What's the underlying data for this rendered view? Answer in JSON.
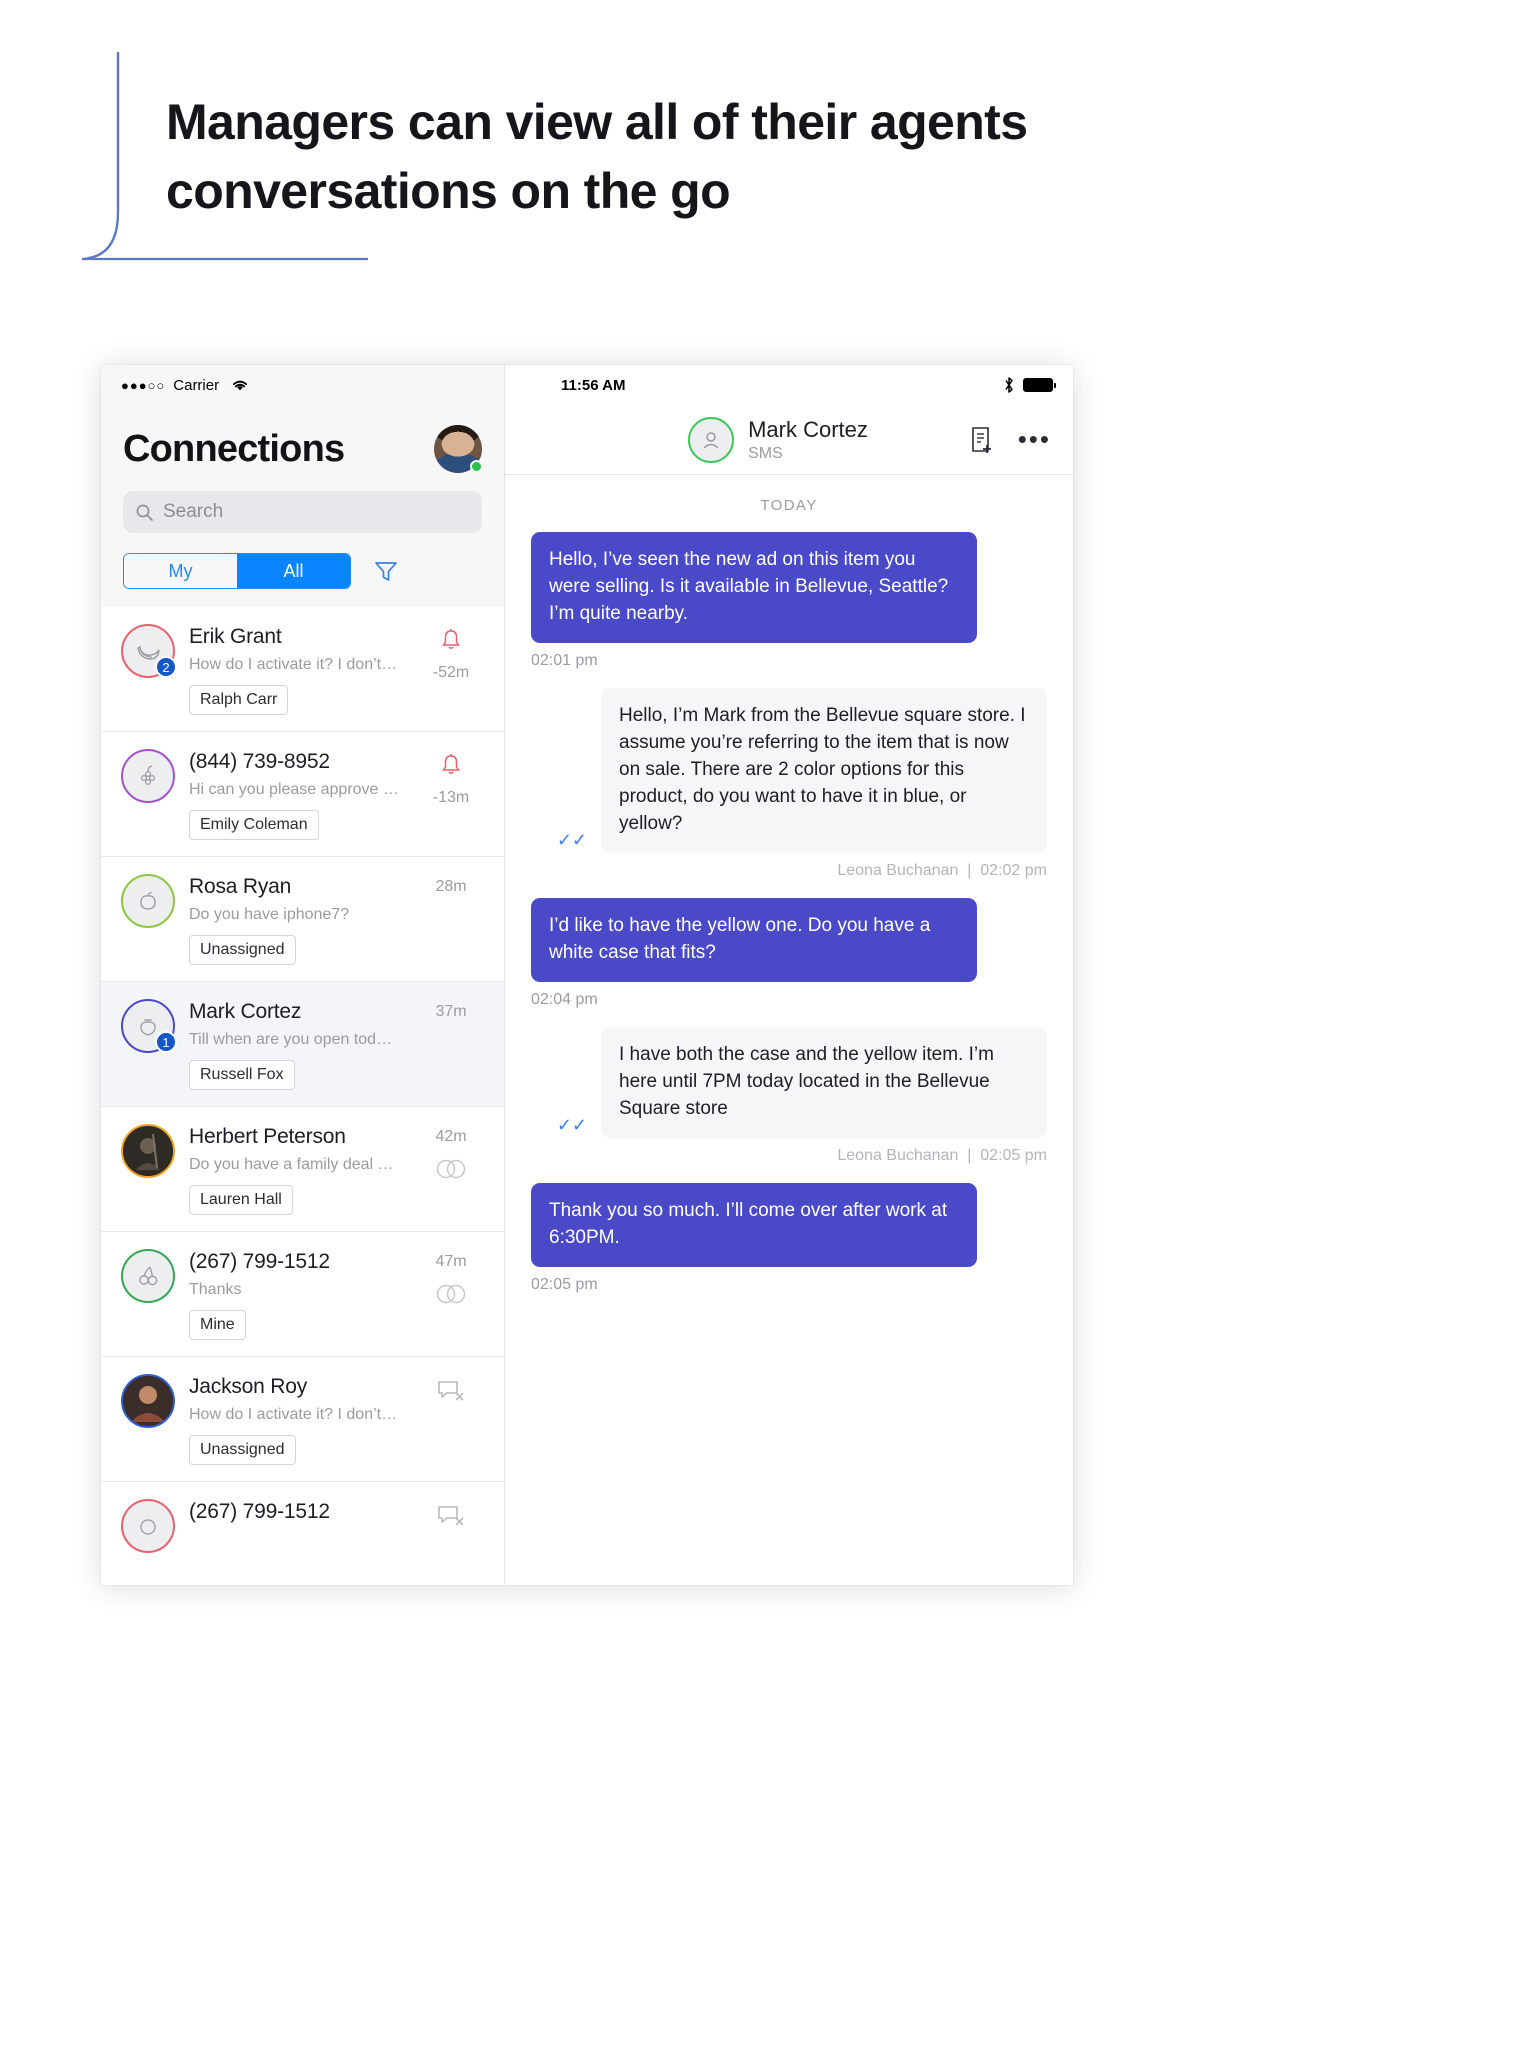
{
  "headline": {
    "line1": "Managers can view all of their agents",
    "line2": "conversations on the go"
  },
  "left_panel": {
    "status_bar": {
      "signal_dots": "●●●○○",
      "carrier": "Carrier",
      "wifi_icon": "wifi-icon"
    },
    "title": "Connections",
    "avatar_icon": "user-avatar",
    "search": {
      "placeholder": "Search",
      "icon": "search-icon"
    },
    "segments": [
      {
        "label": "My",
        "active": false
      },
      {
        "label": "All",
        "active": true
      }
    ],
    "filter_icon": "filter-funnel-icon",
    "conversations": [
      {
        "name": "Erik Grant",
        "preview": "How do I activate it? I don’t s...",
        "tag": "Ralph Carr",
        "time": "-52m",
        "badge": "2",
        "right_icon": "bell-icon",
        "ring_color": "#e8616d",
        "avatar_icon": "banana-icon",
        "selected": false
      },
      {
        "name": "(844) 739-8952",
        "preview": "Hi can you please approve m...",
        "tag": "Emily Coleman",
        "time": "-13m",
        "badge": "",
        "right_icon": "bell-icon",
        "ring_color": "#a352c9",
        "avatar_icon": "grapes-icon",
        "selected": false
      },
      {
        "name": "Rosa Ryan",
        "preview": "Do you have iphone7?",
        "tag": "Unassigned",
        "time": "28m",
        "badge": "",
        "right_icon": "none",
        "ring_color": "#8cc63f",
        "avatar_icon": "apple-icon",
        "selected": false
      },
      {
        "name": "Mark Cortez",
        "preview": "Till when are you open today?",
        "tag": "Russell Fox",
        "time": "37m",
        "badge": "1",
        "right_icon": "none",
        "ring_color": "#4a4ac8",
        "avatar_icon": "strawberry-icon",
        "selected": true
      },
      {
        "name": "Herbert Peterson",
        "preview": "Do you have a family deal with",
        "tag": "Lauren Hall",
        "time": "42m",
        "badge": "",
        "right_icon": "rings-icon",
        "ring_color": "#f2a524",
        "avatar_icon": "photo-avatar",
        "selected": false
      },
      {
        "name": "(267) 799-1512",
        "preview": "Thanks",
        "tag": "Mine",
        "time": "47m",
        "badge": "",
        "right_icon": "rings-icon",
        "ring_color": "#34a853",
        "avatar_icon": "cherry-icon",
        "selected": false
      },
      {
        "name": "Jackson Roy",
        "preview": "How do I activate it? I don’t s...",
        "tag": "Unassigned",
        "time": "",
        "badge": "",
        "right_icon": "muted-chat-icon",
        "ring_color": "#2f5fd0",
        "avatar_icon": "photo-avatar",
        "selected": false
      },
      {
        "name": "(267) 799-1512",
        "preview": "",
        "tag": "",
        "time": "",
        "badge": "",
        "right_icon": "muted-chat-icon",
        "ring_color": "#e8616d",
        "avatar_icon": "fruit-icon",
        "selected": false
      }
    ]
  },
  "right_panel": {
    "status_bar": {
      "time": "11:56 AM",
      "bluetooth_icon": "bluetooth-icon",
      "battery_icon": "battery-full-icon"
    },
    "header": {
      "peer_name": "Mark Cortez",
      "peer_channel": "SMS",
      "avatar_icon": "person-outline-icon",
      "note_icon": "new-note-icon",
      "more_icon": "more-options-icon"
    },
    "day_separator": "TODAY",
    "messages": [
      {
        "direction": "out",
        "lines": [
          "Hello, I’ve seen the new ad on this item you were selling. Is it available in Bellevue, Seattle?",
          "I’m quite nearby."
        ],
        "time": "02:01 pm",
        "sender": "",
        "ticks": false
      },
      {
        "direction": "in",
        "lines": [
          "Hello, I’m Mark from the Bellevue square store. I assume you’re referring to the item that is now on sale. There are 2 color options for this product, do you want to have it in blue, or yellow?"
        ],
        "time": "02:02 pm",
        "sender": "Leona Buchanan",
        "ticks": true
      },
      {
        "direction": "out",
        "lines": [
          "I’d like to have the yellow one. Do you have a white case that fits?"
        ],
        "time": "02:04 pm",
        "sender": "",
        "ticks": false
      },
      {
        "direction": "in",
        "lines": [
          "I have both the case and the yellow item. I’m here until 7PM today located in the Bellevue Square store"
        ],
        "time": "02:05 pm",
        "sender": "Leona Buchanan",
        "ticks": true
      },
      {
        "direction": "out",
        "lines": [
          "Thank you so much. I’ll come over after work at 6:30PM."
        ],
        "time": "02:05 pm",
        "sender": "",
        "ticks": false
      }
    ]
  },
  "colors": {
    "accent_blue": "#0a84ff",
    "bubble_out": "#4a4ac8",
    "bubble_in": "#f6f6f8",
    "badge_blue": "#1357c8",
    "online_green": "#2ec04a"
  }
}
